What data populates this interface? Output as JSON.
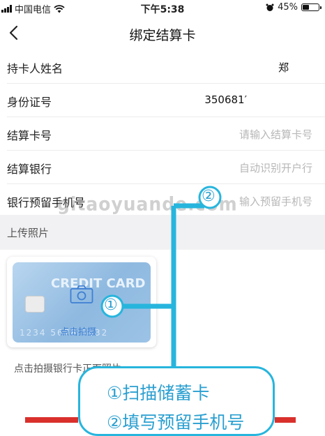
{
  "status_bar": {
    "carrier": "中国电信",
    "time": "下午5:38",
    "battery": "45%",
    "battery_level": 0.45
  },
  "nav": {
    "title": "绑定结算卡"
  },
  "form": {
    "rows": [
      {
        "label": "持卡人姓名",
        "value": "郑",
        "placeholder": ""
      },
      {
        "label": "身份证号",
        "value": "350681′",
        "placeholder": ""
      },
      {
        "label": "结算卡号",
        "value": "",
        "placeholder": "请输入结算卡号"
      },
      {
        "label": "结算银行",
        "value": "",
        "placeholder": "自动识别开户行"
      },
      {
        "label": "银行预留手机号",
        "value": "",
        "placeholder": "输入预留手机号"
      }
    ]
  },
  "upload": {
    "section_title": "上传照片",
    "card_text": "CREDIT CARD",
    "card_number": "1234 5678 5432",
    "shoot_label": "点击拍摄",
    "caption": "点击拍摄银行卡正面照片"
  },
  "watermark": "gitaoyuande.com",
  "annotations": {
    "marker_1": "①",
    "marker_2": "②",
    "line_1": "①扫描储蓄卡",
    "line_2": "②填写预留手机号",
    "color": "#27b5dd"
  },
  "colors": {
    "placeholder": "#b7b7b7",
    "section_bg": "#f1f1f3",
    "accent_blue": "#3e7fd3",
    "bottom_button": "#d9302c"
  }
}
